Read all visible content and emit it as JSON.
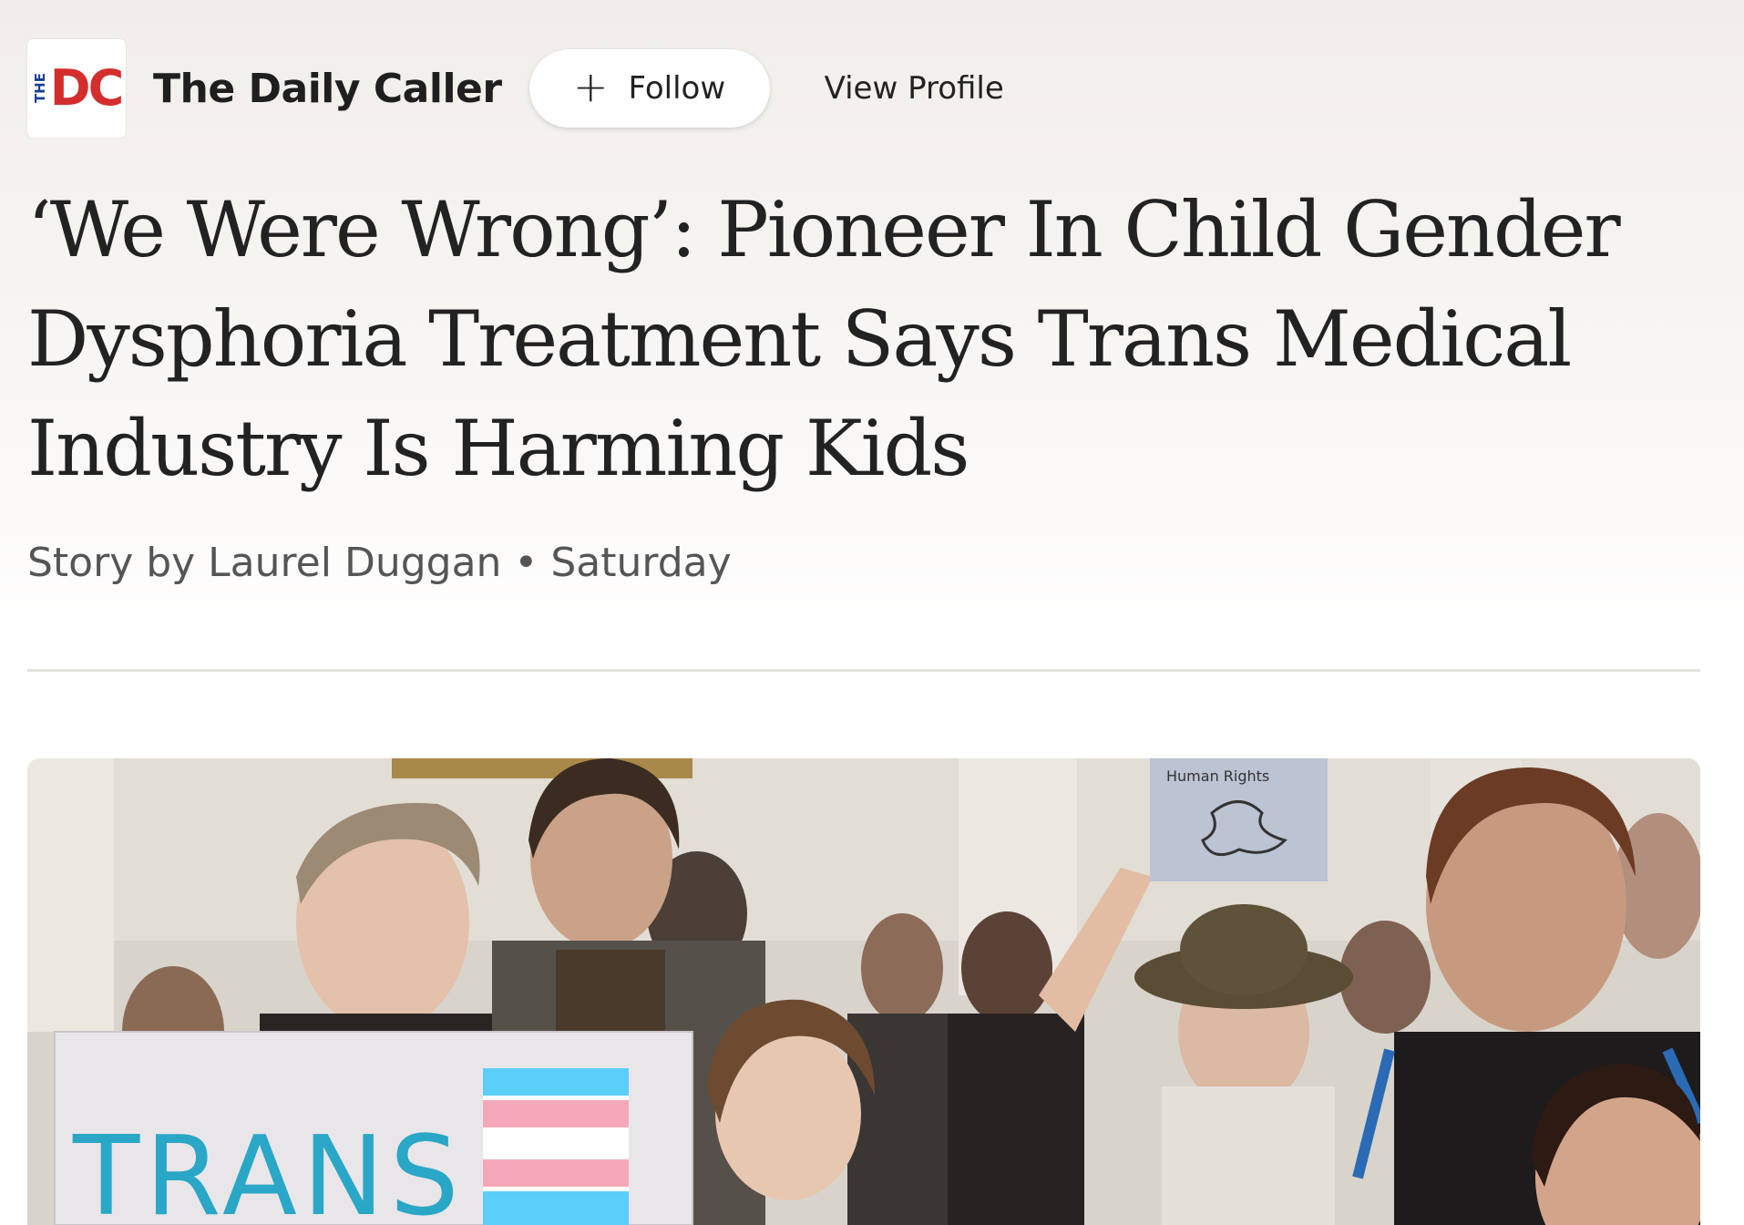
{
  "publisher": {
    "logo_the": "THE",
    "logo_dc": "DC",
    "name": "The Daily Caller"
  },
  "actions": {
    "follow_icon": "plus-icon",
    "follow_label": "Follow",
    "view_profile_label": "View Profile"
  },
  "article": {
    "headline": "‘We Were Wrong’: Pioneer In Child Gender Dysphoria Treatment Says Trans Medical Industry Is Harming Kids",
    "byline_prefix": "Story by Laurel Duggan",
    "byline_separator": "•",
    "byline_date": "Saturday"
  },
  "hero_image": {
    "sign_left_text": "TRANS",
    "sign_right_text": "Human Rights"
  },
  "colors": {
    "logo_red": "#d42d2d",
    "logo_blue": "#1c3f8f",
    "trans_blue": "#5bcefa",
    "trans_pink": "#f5a9b8"
  }
}
